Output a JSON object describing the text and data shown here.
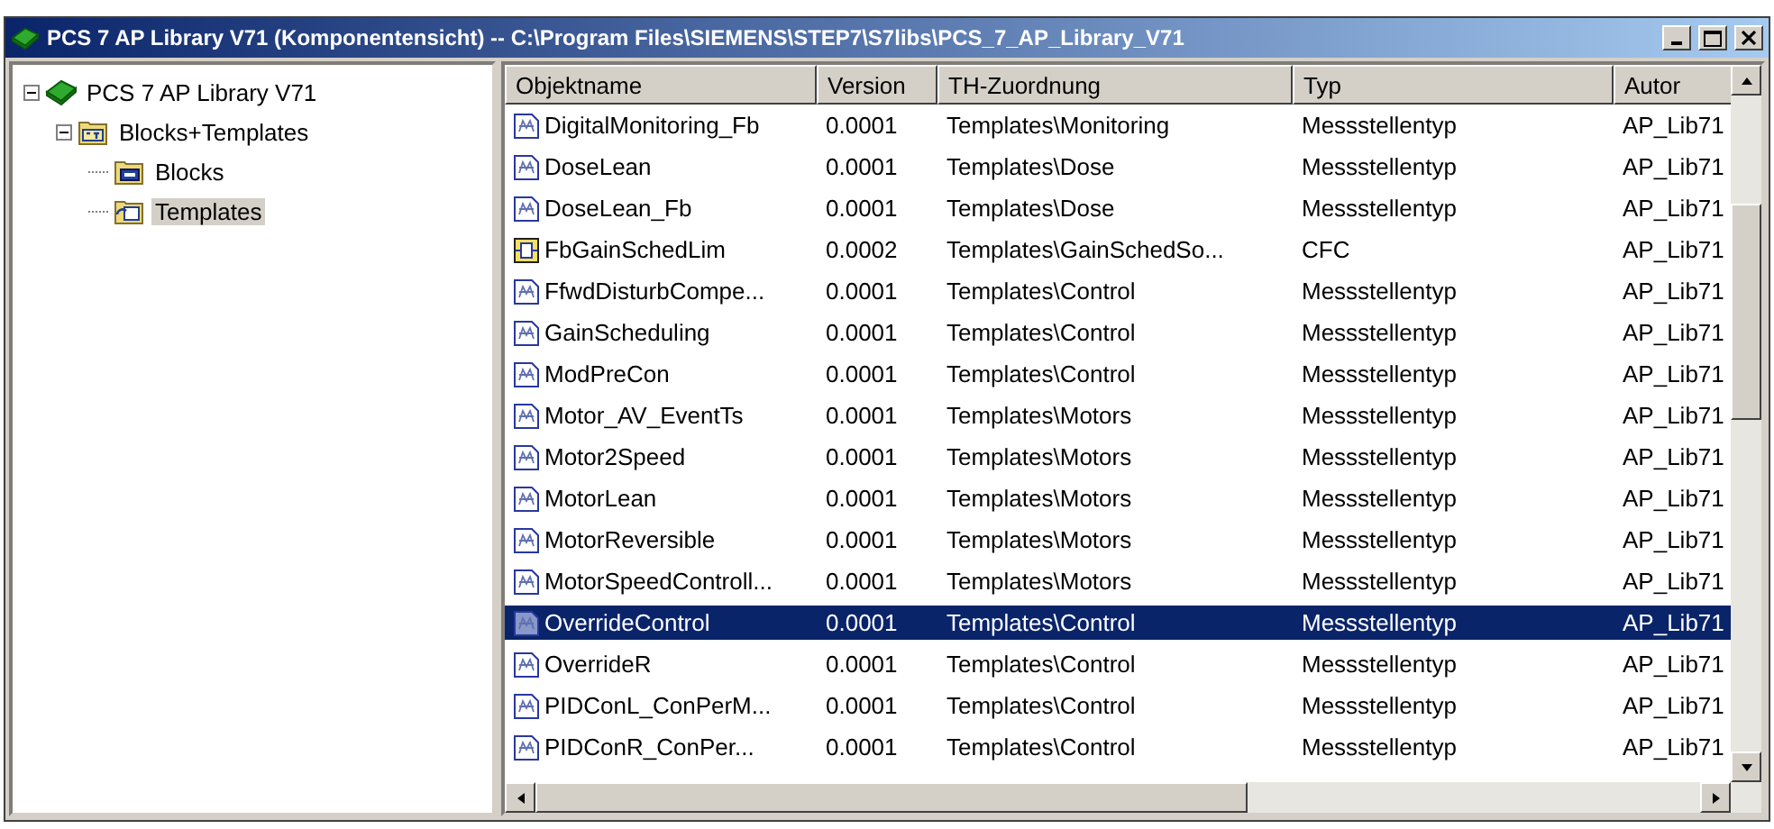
{
  "window": {
    "title": "PCS 7 AP Library V71 (Komponentensicht) -- C:\\Program Files\\SIEMENS\\STEP7\\S7libs\\PCS_7_AP_Library_V71"
  },
  "tree": [
    {
      "label": "PCS 7 AP Library V71",
      "kind": "library",
      "expanded": true,
      "selected": false,
      "children": [
        {
          "label": "Blocks+Templates",
          "kind": "s7folder",
          "expanded": true,
          "selected": false,
          "children": [
            {
              "label": "Blocks",
              "kind": "blocks",
              "selected": false
            },
            {
              "label": "Templates",
              "kind": "templates",
              "selected": true
            }
          ]
        }
      ]
    }
  ],
  "table": {
    "columns": [
      "Objektname",
      "Version",
      "TH-Zuordnung",
      "Typ",
      "Autor"
    ],
    "rows": [
      {
        "kind": "template",
        "selected": false,
        "cells": [
          "DigitalMonitoring_Fb",
          "0.0001",
          "Templates\\Monitoring",
          "Messstellentyp",
          "AP_Lib71"
        ]
      },
      {
        "kind": "template",
        "selected": false,
        "cells": [
          "DoseLean",
          "0.0001",
          "Templates\\Dose",
          "Messstellentyp",
          "AP_Lib71"
        ]
      },
      {
        "kind": "template",
        "selected": false,
        "cells": [
          "DoseLean_Fb",
          "0.0001",
          "Templates\\Dose",
          "Messstellentyp",
          "AP_Lib71"
        ]
      },
      {
        "kind": "cfc",
        "selected": false,
        "cells": [
          "FbGainSchedLim",
          "0.0002",
          "Templates\\GainSchedSo...",
          "CFC",
          "AP_Lib71"
        ]
      },
      {
        "kind": "template",
        "selected": false,
        "cells": [
          "FfwdDisturbCompe...",
          "0.0001",
          "Templates\\Control",
          "Messstellentyp",
          "AP_Lib71"
        ]
      },
      {
        "kind": "template",
        "selected": false,
        "cells": [
          "GainScheduling",
          "0.0001",
          "Templates\\Control",
          "Messstellentyp",
          "AP_Lib71"
        ]
      },
      {
        "kind": "template",
        "selected": false,
        "cells": [
          "ModPreCon",
          "0.0001",
          "Templates\\Control",
          "Messstellentyp",
          "AP_Lib71"
        ]
      },
      {
        "kind": "template",
        "selected": false,
        "cells": [
          "Motor_AV_EventTs",
          "0.0001",
          "Templates\\Motors",
          "Messstellentyp",
          "AP_Lib71"
        ]
      },
      {
        "kind": "template",
        "selected": false,
        "cells": [
          "Motor2Speed",
          "0.0001",
          "Templates\\Motors",
          "Messstellentyp",
          "AP_Lib71"
        ]
      },
      {
        "kind": "template",
        "selected": false,
        "cells": [
          "MotorLean",
          "0.0001",
          "Templates\\Motors",
          "Messstellentyp",
          "AP_Lib71"
        ]
      },
      {
        "kind": "template",
        "selected": false,
        "cells": [
          "MotorReversible",
          "0.0001",
          "Templates\\Motors",
          "Messstellentyp",
          "AP_Lib71"
        ]
      },
      {
        "kind": "template",
        "selected": false,
        "cells": [
          "MotorSpeedControll...",
          "0.0001",
          "Templates\\Motors",
          "Messstellentyp",
          "AP_Lib71"
        ]
      },
      {
        "kind": "template",
        "selected": true,
        "cells": [
          "OverrideControl",
          "0.0001",
          "Templates\\Control",
          "Messstellentyp",
          "AP_Lib71"
        ]
      },
      {
        "kind": "template",
        "selected": false,
        "cells": [
          "OverrideR",
          "0.0001",
          "Templates\\Control",
          "Messstellentyp",
          "AP_Lib71"
        ]
      },
      {
        "kind": "template",
        "selected": false,
        "cells": [
          "PIDConL_ConPerM...",
          "0.0001",
          "Templates\\Control",
          "Messstellentyp",
          "AP_Lib71"
        ]
      },
      {
        "kind": "template",
        "selected": false,
        "cells": [
          "PIDConR_ConPer...",
          "0.0001",
          "Templates\\Control",
          "Messstellentyp",
          "AP_Lib71"
        ]
      }
    ]
  }
}
